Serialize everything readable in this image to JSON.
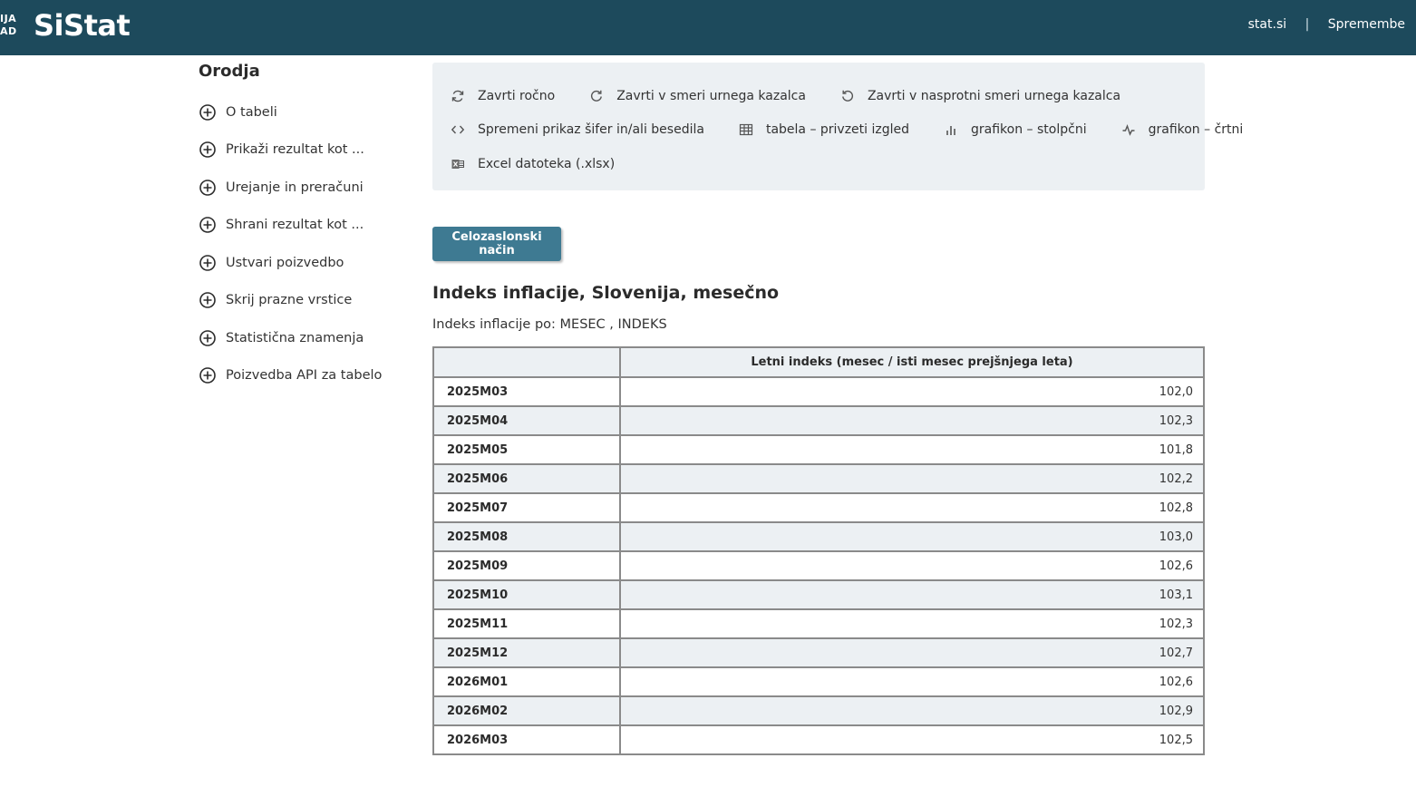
{
  "header": {
    "logo_small_line1": "IJA",
    "logo_small_line2": "AD",
    "logo": "SiStat",
    "nav": [
      "stat.si",
      "Spremembe"
    ],
    "nav_separator": "|"
  },
  "sidebar": {
    "title": "Orodja",
    "items": [
      {
        "label": "O tabeli"
      },
      {
        "label": "Prikaži rezultat kot ..."
      },
      {
        "label": "Urejanje in preračuni"
      },
      {
        "label": "Shrani rezultat kot ..."
      },
      {
        "label": "Ustvari poizvedbo"
      },
      {
        "label": "Skrij prazne vrstice"
      },
      {
        "label": "Statistična znamenja"
      },
      {
        "label": "Poizvedba API za tabelo"
      }
    ],
    "item_icon": "plus-circle-icon"
  },
  "tools": {
    "row1": [
      {
        "label": "Zavrti ročno",
        "icon": "rotate-manual-icon"
      },
      {
        "label": "Zavrti v smeri urnega kazalca",
        "icon": "rotate-clockwise-icon"
      },
      {
        "label": "Zavrti v nasprotni smeri urnega kazalca",
        "icon": "rotate-counterclockwise-icon"
      }
    ],
    "row2": [
      {
        "label": "Spremeni prikaz šifer in/ali besedila",
        "icon": "code-icon"
      },
      {
        "label": "tabela – privzeti izgled",
        "icon": "table-icon"
      },
      {
        "label": "grafikon – stolpčni",
        "icon": "bar-chart-icon"
      },
      {
        "label": "grafikon – črtni",
        "icon": "line-chart-icon"
      }
    ],
    "row3": [
      {
        "label": "Excel datoteka (.xlsx)",
        "icon": "excel-icon"
      }
    ]
  },
  "main": {
    "fullscreen_button": "Celozaslonski način",
    "title": "Indeks inflacije, Slovenija, mesečno",
    "subtitle": "Indeks inflacije po: MESEC , INDEKS",
    "table": {
      "column_header": "Letni indeks (mesec / isti mesec prejšnjega leta)",
      "rows": [
        {
          "month": "2025M03",
          "value": "102,0"
        },
        {
          "month": "2025M04",
          "value": "102,3"
        },
        {
          "month": "2025M05",
          "value": "101,8"
        },
        {
          "month": "2025M06",
          "value": "102,2"
        },
        {
          "month": "2025M07",
          "value": "102,8"
        },
        {
          "month": "2025M08",
          "value": "103,0"
        },
        {
          "month": "2025M09",
          "value": "102,6"
        },
        {
          "month": "2025M10",
          "value": "103,1"
        },
        {
          "month": "2025M11",
          "value": "102,3"
        },
        {
          "month": "2025M12",
          "value": "102,7"
        },
        {
          "month": "2026M01",
          "value": "102,6"
        },
        {
          "month": "2026M02",
          "value": "102,9"
        },
        {
          "month": "2026M03",
          "value": "102,5"
        }
      ]
    }
  },
  "colors": {
    "header_bg": "#1d4a5c",
    "button_bg": "#3e7a92",
    "panel_bg": "#ecf0f3"
  }
}
